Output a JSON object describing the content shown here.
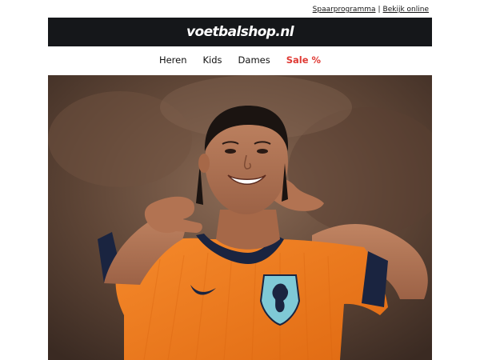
{
  "top_links": {
    "savings_label": "Spaarprogramma",
    "separator": "|",
    "view_online_label": "Bekijk online"
  },
  "brand": {
    "logo_text": "voetbalshop.nl"
  },
  "nav": {
    "items": [
      {
        "label": "Heren"
      },
      {
        "label": "Kids"
      },
      {
        "label": "Dames"
      },
      {
        "label": "Sale %"
      }
    ]
  },
  "colors": {
    "brand_bar": "#15171a",
    "sale": "#e03b35",
    "jersey_orange": "#f07a1c",
    "jersey_navy": "#1a2440",
    "badge_blue": "#7fc9d6"
  },
  "hero": {
    "image_subject": "player-in-orange-jersey"
  }
}
